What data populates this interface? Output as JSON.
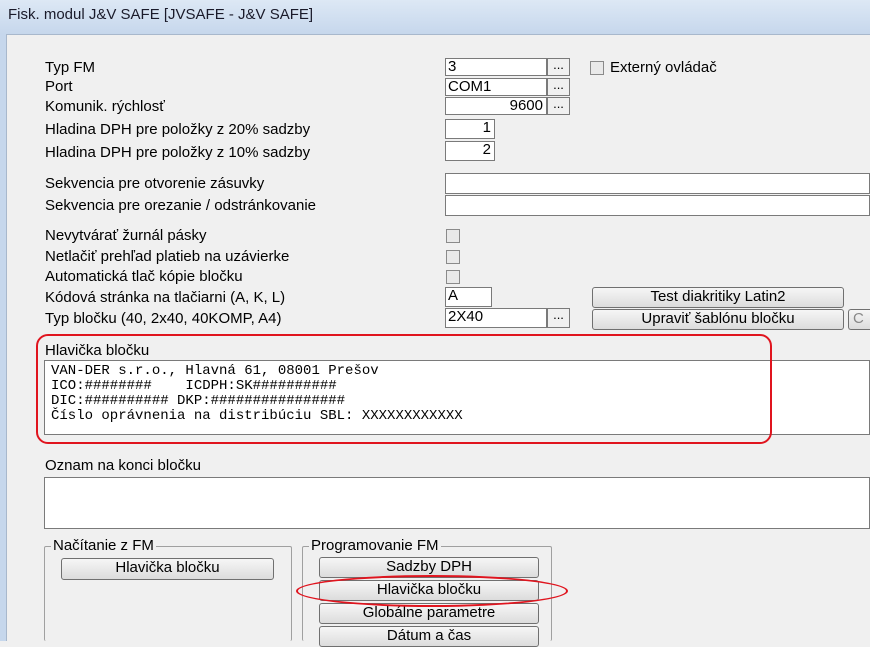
{
  "window": {
    "title": "Fisk. modul  J&V SAFE   [JVSAFE - J&V SAFE]"
  },
  "fields": {
    "typ_fm": {
      "label": "Typ FM",
      "value": "3"
    },
    "port": {
      "label": "Port",
      "value": "COM1"
    },
    "rychlost": {
      "label": "Komunik. rýchlosť",
      "value": "9600"
    },
    "dph20": {
      "label": "Hladina DPH pre položky z 20% sadzby",
      "value": "1"
    },
    "dph10": {
      "label": "Hladina DPH pre položky z 10% sadzby",
      "value": "2"
    },
    "zasuvka": {
      "label": "Sekvencia pre otvorenie zásuvky",
      "value": ""
    },
    "orezanie": {
      "label": "Sekvencia pre orezanie / odstránkovanie",
      "value": ""
    },
    "nevytvarat": {
      "label": "Nevytvárať  žurnál pásky"
    },
    "netlacit": {
      "label": "Netlačiť prehľad platieb na uzávierke"
    },
    "automaticka": {
      "label": "Automatická tlač kópie bločku"
    },
    "kodova": {
      "label": "Kódová stránka na tlačiarni (A, K, L)",
      "value": "A"
    },
    "typ_blocku": {
      "label": "Typ bločku (40, 2x40, 40KOMP, A4)",
      "value": "2X40"
    }
  },
  "externy": {
    "label": "Externý ovládač"
  },
  "buttons": {
    "dots": "...",
    "test_diakritiky": "Test diakritiky Latin2",
    "upravit_sablonu": "Upraviť šablónu bločku",
    "cut_off": "C"
  },
  "hlavicka": {
    "label": "Hlavička bločku",
    "lines": [
      "VAN-DER s.r.o., Hlavná 61, 08001 Prešov",
      "ICO:########    ICDPH:SK##########",
      "DIC:########## DKP:################",
      "Číslo oprávnenia na distribúciu SBL: XXXXXXXXXXXX"
    ]
  },
  "oznam": {
    "label": "Oznam na konci bločku",
    "value": ""
  },
  "nacitanie": {
    "caption": "Načítanie z FM",
    "hlavicka_btn": "Hlavička bločku"
  },
  "programovanie": {
    "caption": "Programovanie FM",
    "sadzby_btn": "Sadzby DPH",
    "hlavicka_btn": "Hlavička bločku",
    "globalne_btn": "Globálne parametre",
    "datum_btn": "Dátum a čas"
  },
  "colors": {
    "highlight": "#e0141e"
  }
}
